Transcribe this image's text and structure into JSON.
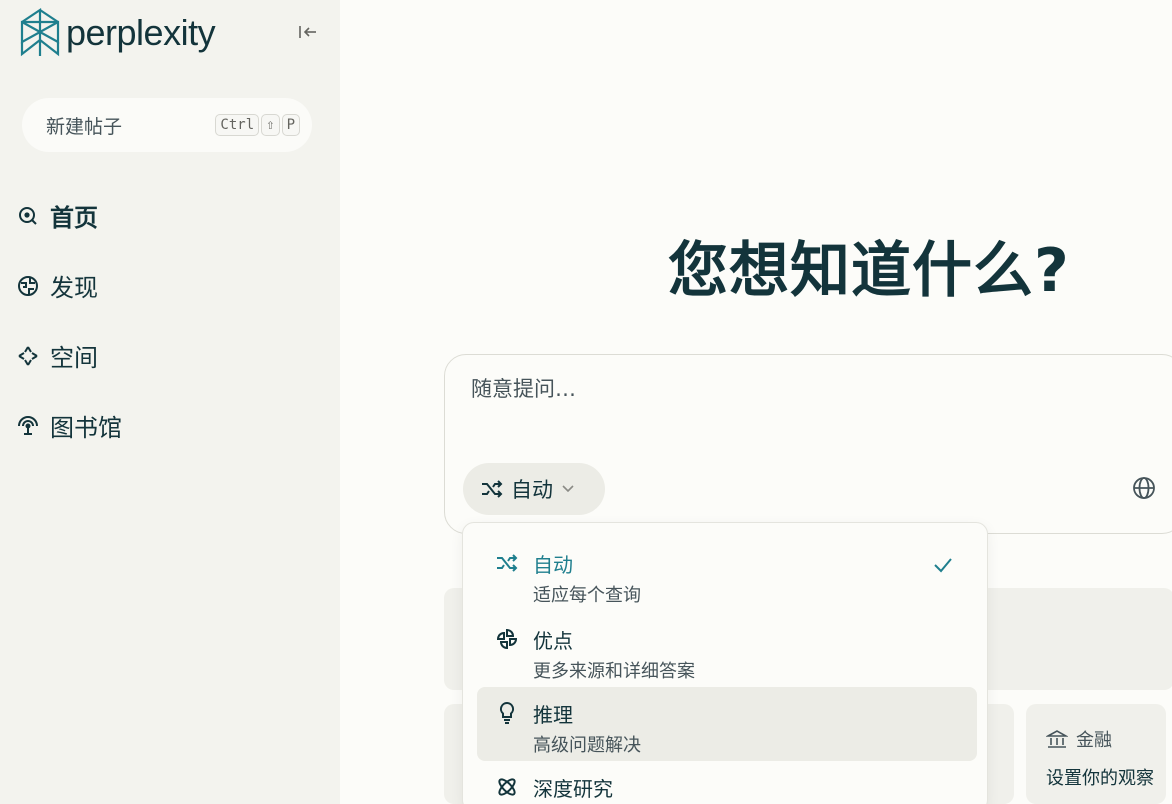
{
  "app": {
    "brand": "perplexity",
    "accent": "#1f7f8e"
  },
  "sidebar": {
    "new_thread": {
      "label": "新建帖子",
      "shortcut": [
        "Ctrl",
        "⇧",
        "P"
      ]
    },
    "items": [
      {
        "label": "首页",
        "icon": "search-circle-icon",
        "active": true
      },
      {
        "label": "发现",
        "icon": "globe-icon",
        "active": false
      },
      {
        "label": "空间",
        "icon": "sparkle-grid-icon",
        "active": false
      },
      {
        "label": "图书馆",
        "icon": "library-icon",
        "active": false
      }
    ]
  },
  "main": {
    "headline": "您想知道什么?",
    "search": {
      "placeholder": "随意提问…"
    },
    "mode_button": {
      "label": "自动",
      "icon": "shuffle-icon"
    },
    "finance_card": {
      "title": "金融",
      "subtitle": "设置你的观察"
    }
  },
  "mode_menu": {
    "items": [
      {
        "title": "自动",
        "desc": "适应每个查询",
        "icon": "shuffle-icon",
        "selected": true
      },
      {
        "title": "优点",
        "desc": "更多来源和详细答案",
        "icon": "pro-icon",
        "selected": false
      },
      {
        "title": "推理",
        "desc": "高级问题解决",
        "icon": "lightbulb-icon",
        "selected": false
      },
      {
        "title": "深度研究",
        "desc": "",
        "icon": "atom-icon",
        "selected": false
      }
    ]
  }
}
